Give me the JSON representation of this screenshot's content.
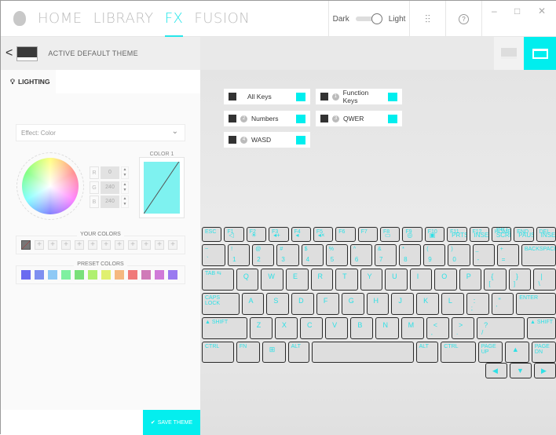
{
  "nav": {
    "items": [
      "HOME",
      "LIBRARY",
      "FX",
      "FUSION"
    ],
    "active": "FX"
  },
  "toolbar": {
    "dark": "Dark",
    "light": "Light",
    "help": "?",
    "minimize": "–",
    "maximize": "□",
    "close": "✕"
  },
  "theme": {
    "back": "<",
    "title": "ACTIVE DEFAULT THEME"
  },
  "tabs": {
    "lighting": "LIGHTING"
  },
  "effect": {
    "value": "Effect: Color",
    "chevron": "⌄"
  },
  "rgb": [
    {
      "label": "R",
      "value": "0"
    },
    {
      "label": "G",
      "value": "240"
    },
    {
      "label": "B",
      "value": "240"
    }
  ],
  "color1": {
    "label": "COLOR 1",
    "hex": "#00F0F0"
  },
  "your_colors": {
    "label": "YOUR COLORS",
    "add": "+"
  },
  "preset_colors": {
    "label": "PRESET COLORS",
    "colors": [
      "#6b6bf0",
      "#7f8ff0",
      "#8ec9f5",
      "#7ff0a0",
      "#7ae07a",
      "#b0f070",
      "#e0f070",
      "#f5b880",
      "#f07a7a",
      "#d07ab8",
      "#d07ad8",
      "#9a7af0"
    ]
  },
  "save": {
    "icon": "✔",
    "label": "SAVE THEME"
  },
  "zones": [
    {
      "label": "All Keys",
      "num": ""
    },
    {
      "label": "Function Keys",
      "num": "1"
    },
    {
      "label": "Numbers",
      "num": "2"
    },
    {
      "label": "QWER",
      "num": "3"
    },
    {
      "label": "WASD",
      "num": "4"
    }
  ],
  "accent": "#00eeee",
  "keyboard": [
    [
      [
        "ESC",
        ""
      ],
      [
        "F1",
        "◁"
      ],
      [
        "F2",
        "☀"
      ],
      [
        "F3",
        "◂+"
      ],
      [
        "F4",
        "◂"
      ],
      [
        "F5",
        "◂×"
      ],
      [
        "F6",
        ""
      ],
      [
        "F7",
        ""
      ],
      [
        "F8",
        "▭"
      ],
      [
        "F9",
        "◎"
      ],
      [
        "F10",
        "▣"
      ],
      [
        "F11",
        "PRTSC"
      ],
      [
        "F12",
        "INSERT"
      ],
      [
        "HOME",
        "PRT SCRN"
      ],
      [
        "END",
        "PAUSE"
      ],
      [
        "DEL",
        "INSERT"
      ]
    ],
    [
      [
        "~",
        "`"
      ],
      [
        "!",
        "1"
      ],
      [
        "@",
        "2"
      ],
      [
        "#",
        "3"
      ],
      [
        "$",
        "4"
      ],
      [
        "%",
        "5"
      ],
      [
        "^",
        "6"
      ],
      [
        "&",
        "7"
      ],
      [
        "*",
        "8"
      ],
      [
        "(",
        "9"
      ],
      [
        ")",
        "0"
      ],
      [
        "_",
        "-"
      ],
      [
        "+",
        "="
      ],
      [
        "BACKSPACE",
        ""
      ]
    ],
    [
      [
        "TAB ⇆",
        ""
      ],
      [
        "Q",
        ""
      ],
      [
        "W",
        ""
      ],
      [
        "E",
        ""
      ],
      [
        "R",
        ""
      ],
      [
        "T",
        ""
      ],
      [
        "Y",
        ""
      ],
      [
        "U",
        ""
      ],
      [
        "I",
        ""
      ],
      [
        "O",
        ""
      ],
      [
        "P",
        ""
      ],
      [
        "{",
        "["
      ],
      [
        "}",
        "]"
      ],
      [
        "|",
        "\\"
      ]
    ],
    [
      [
        "CAPS LOCK",
        ""
      ],
      [
        "A",
        ""
      ],
      [
        "S",
        ""
      ],
      [
        "D",
        ""
      ],
      [
        "F",
        ""
      ],
      [
        "G",
        ""
      ],
      [
        "H",
        ""
      ],
      [
        "J",
        ""
      ],
      [
        "K",
        ""
      ],
      [
        "L",
        ""
      ],
      [
        ":",
        ";"
      ],
      [
        "\"",
        "'"
      ],
      [
        "ENTER",
        ""
      ]
    ],
    [
      [
        "▲ SHIFT",
        ""
      ],
      [
        "Z",
        ""
      ],
      [
        "X",
        ""
      ],
      [
        "C",
        ""
      ],
      [
        "V",
        ""
      ],
      [
        "B",
        ""
      ],
      [
        "N",
        ""
      ],
      [
        "M",
        ""
      ],
      [
        "<",
        ","
      ],
      [
        ">",
        "."
      ],
      [
        "?",
        "/"
      ],
      [
        "▲ SHIFT",
        ""
      ]
    ],
    [
      [
        "CTRL",
        ""
      ],
      [
        "FN",
        ""
      ],
      [
        "⊞",
        ""
      ],
      [
        "ALT",
        ""
      ],
      [
        "",
        ""
      ],
      [
        "ALT",
        ""
      ],
      [
        "CTRL",
        ""
      ],
      [
        "PAGE UP",
        ""
      ],
      [
        "▲",
        ""
      ],
      [
        "PAGE DN",
        ""
      ]
    ],
    [
      [
        "◀",
        ""
      ],
      [
        "▼",
        ""
      ],
      [
        "▶",
        ""
      ]
    ]
  ]
}
